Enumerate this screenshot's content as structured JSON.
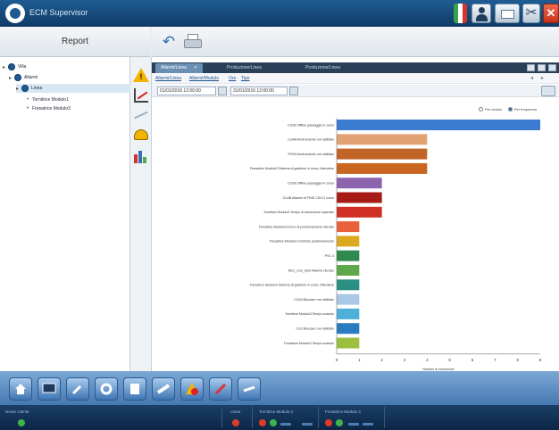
{
  "app": {
    "title": "ECM Supervisor"
  },
  "sidebar": {
    "header": "Report",
    "tree": [
      {
        "label": "Villa",
        "level": 0,
        "selected": false
      },
      {
        "label": "Allarmi",
        "level": 1,
        "selected": false
      },
      {
        "label": "Linea",
        "level": 2,
        "selected": true
      },
      {
        "label": "Tornitrice Modulo1",
        "level": 3,
        "selected": false
      },
      {
        "label": "Fresatrice Modulo3",
        "level": 3,
        "selected": false
      }
    ]
  },
  "report_types": [
    {
      "icon": "warning-icon"
    },
    {
      "icon": "line-chart-icon"
    },
    {
      "icon": "trend-icon"
    },
    {
      "icon": "gauge-icon"
    },
    {
      "icon": "bar-chart-icon"
    }
  ],
  "toolbar": {
    "back_icon": "back-arrow-icon",
    "print_icon": "printer-icon"
  },
  "tabs": [
    {
      "label": "Allarmi/Linea",
      "active": true
    },
    {
      "label": "Produzione/Linea",
      "active": false
    },
    {
      "label": "Produzione/Linea",
      "active": false
    }
  ],
  "links": [
    "Allarmi/Linea",
    "Allarmi/Modulo",
    "Ore",
    "Tipo"
  ],
  "filter": {
    "from": "01/01/2016 12:00:00",
    "to": "31/01/2016 12:00:00"
  },
  "legend": {
    "options": [
      "Per durata",
      "Per frequenza"
    ],
    "selected": "Per frequenza"
  },
  "colors": {
    "titlebar": "#13446f",
    "accent": "#1f5c93",
    "bars": [
      "#3b7bd0",
      "#e2a274",
      "#c06428",
      "#c8651e",
      "#8c64ad",
      "#a61b15",
      "#cf2f25",
      "#e8613a",
      "#dba81f",
      "#2e8a4e",
      "#5fa84a",
      "#2a8f83",
      "#a8c8e5",
      "#4cb0d8",
      "#2a7cc0",
      "#9cbf42",
      "#dd5a30",
      "#c7332d",
      "#2e8a4e",
      "#3a82c9"
    ]
  },
  "chart_data": {
    "type": "bar",
    "orientation": "horizontal",
    "categories": [
      "CU2B Offline passaggio in corso",
      "CU4B Arretramento non abilitato",
      "PVN3 Arretramento non abilitato",
      "Fresatrice Modulo3 Sistema di gestione in corso. Attendere",
      "CU2B Offline passaggio in corso",
      "CU4B Allarme di FINE CICLO corso",
      "Tornitrice Modulo3 Tempo di esecuzione superato",
      "Fresatrice Modulo3 Errore di posizionamento rilevato",
      "Fresatrice Modulo3 Controllo posizionamento",
      "PVC 4",
      "REC_Line_Alert Allarme rilevato",
      "Fresatrice Modulo3 Sistema di gestione in corso. Attendere",
      "CU2A Bloccare non abilitato",
      "Tornitrice Modulo3 Tempo scaduto",
      "CU2 Bloccare non abilitato",
      "Fresatrice Modulo3 Tempo scaduto"
    ],
    "values": [
      9,
      4,
      4,
      4,
      2,
      2,
      2,
      1,
      1,
      1,
      1,
      1,
      1,
      1,
      1,
      1
    ],
    "xlim": [
      0,
      9
    ],
    "x_ticks": [
      "0",
      "1",
      "2",
      "3",
      "4",
      "5",
      "6",
      "7",
      "8",
      "9"
    ],
    "xlabel": "Numero di occorrenze",
    "grid": false
  },
  "dock": {
    "buttons": [
      {
        "name": "home-button",
        "icon": "home-icon"
      },
      {
        "name": "monitor-button",
        "icon": "monitor-icon"
      },
      {
        "name": "tools-button",
        "icon": "wrench-icon"
      },
      {
        "name": "maintenance-button",
        "icon": "gear-icon"
      },
      {
        "name": "document-button",
        "icon": "document-icon"
      },
      {
        "name": "pipeline-button",
        "icon": "pipe-icon"
      },
      {
        "name": "alarm-button",
        "icon": "alarm-icon"
      },
      {
        "name": "edit-button",
        "icon": "pencil-icon"
      },
      {
        "name": "settings-button",
        "icon": "wrench2-icon"
      }
    ]
  },
  "statusbar": {
    "user_label": "Nome Utente",
    "linea_label": "Linea",
    "mod2_label": "Tornitrice Modulo 2",
    "mod3_label": "Fresatrice Modulo 3"
  }
}
